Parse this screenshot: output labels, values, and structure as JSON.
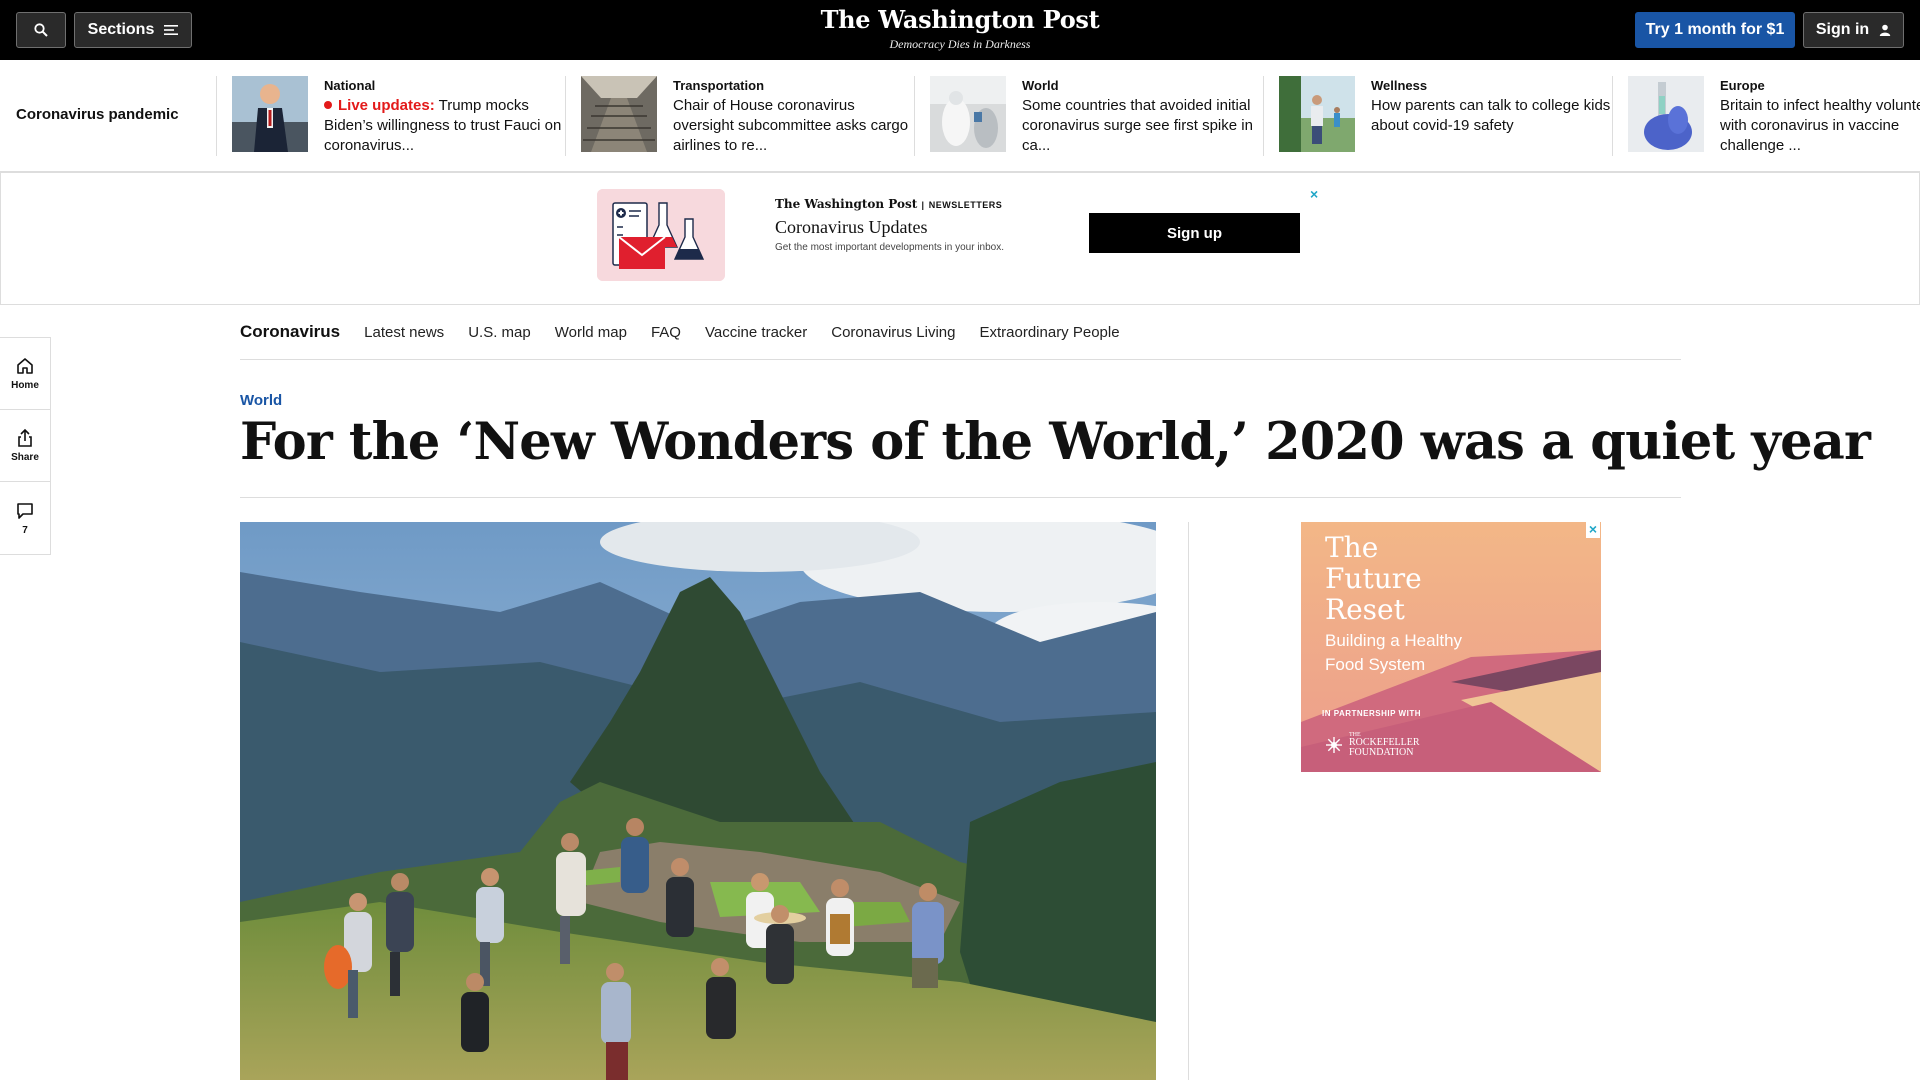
{
  "header": {
    "sections_label": "Sections",
    "logo": "The Washington Post",
    "tagline": "Democracy Dies in Darkness",
    "try_label": "Try 1 month for $1",
    "signin_label": "Sign in"
  },
  "strip": {
    "label": "Coronavirus pandemic",
    "items": [
      {
        "kicker": "National",
        "live": "Live updates:",
        "headline": "Trump mocks Biden’s willingness to trust Fauci on coronavirus..."
      },
      {
        "kicker": "Transportation",
        "headline": "Chair of House coronavirus oversight subcommittee asks cargo airlines to re..."
      },
      {
        "kicker": "World",
        "headline": "Some countries that avoided initial coronavirus surge see first spike in ca..."
      },
      {
        "kicker": "Wellness",
        "headline": "How parents can talk to college kids about covid-19 safety"
      },
      {
        "kicker": "Europe",
        "headline": "Britain to infect healthy volunteers with coronavirus in vaccine challenge ..."
      }
    ]
  },
  "newsletter": {
    "logo": "The Washington Post",
    "logo_sub": "NEWSLETTERS",
    "title": "Coronavirus Updates",
    "desc": "Get the most important developments in your inbox.",
    "button": "Sign up",
    "close": "×"
  },
  "secnav": {
    "title": "Coronavirus",
    "links": [
      "Latest news",
      "U.S. map",
      "World map",
      "FAQ",
      "Vaccine tracker",
      "Coronavirus Living",
      "Extraordinary People"
    ]
  },
  "rail": {
    "home": "Home",
    "share": "Share",
    "comments": "7"
  },
  "article": {
    "kicker": "World",
    "headline": "For the ‘New Wonders of the World,’ 2020 was a quiet year"
  },
  "ad": {
    "title": [
      "The",
      "Future",
      "Reset"
    ],
    "subtitle": [
      "Building a Healthy",
      "Food System"
    ],
    "partnership": "IN PARTNERSHIP WITH",
    "sponsor_small": "THE",
    "sponsor": [
      "ROCKEFELLER",
      "FOUNDATION"
    ],
    "close": "×"
  },
  "icons": {
    "search": "search-icon",
    "sections": "menu-icon",
    "signin": "user-icon",
    "home": "home-icon",
    "share": "share-icon",
    "comments": "comment-icon",
    "close": "close-icon"
  },
  "colors": {
    "accent": "#1955a5",
    "live": "#e31a1a",
    "ad_close": "#1fa6c7"
  }
}
